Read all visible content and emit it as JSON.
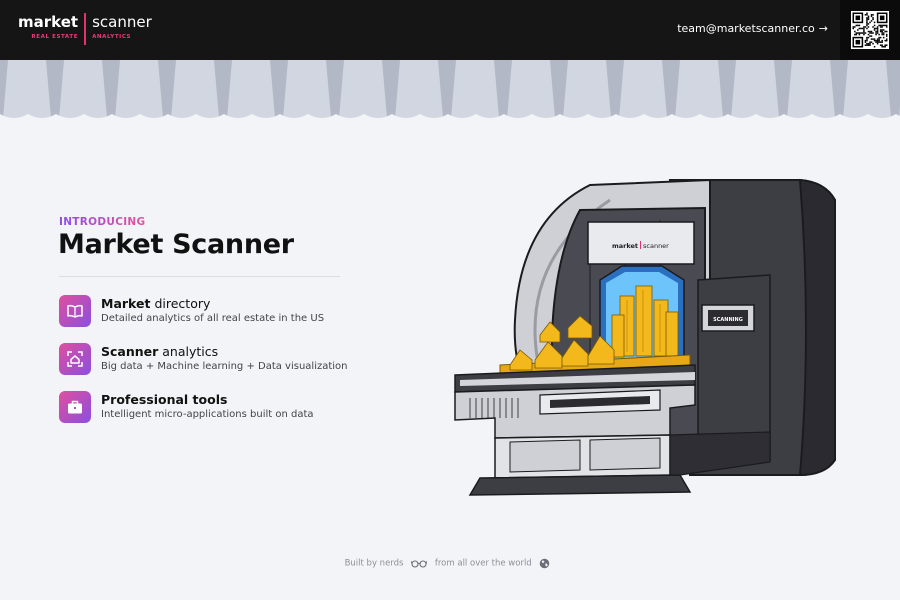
{
  "header": {
    "logo": {
      "word_left": "market",
      "word_right": "scanner",
      "sub_left": "REAL ESTATE",
      "sub_right": "ANALYTICS"
    },
    "email": "team@marketscanner.co",
    "email_arrow_icon": "arrow-right-icon",
    "qr_icon": "qr-code-icon"
  },
  "colors": {
    "header_bg": "#151515",
    "accent_pink": "#e6306f",
    "accent_purple": "#8a4de8",
    "page_bg": "#f3f4f7",
    "scanner_blue": "#3aa0f0",
    "gold": "#f2b81c"
  },
  "intro": {
    "eyebrow": "INTRODUCING",
    "title": "Market Scanner"
  },
  "features": [
    {
      "icon": "book-icon",
      "title_bold": "Market",
      "title_rest": " directory",
      "desc": "Detailed analytics of all real estate in the US"
    },
    {
      "icon": "scan-home-icon",
      "title_bold": "Scanner",
      "title_rest": " analytics",
      "desc": "Big data + Machine learning + Data visualization"
    },
    {
      "icon": "briefcase-icon",
      "title_bold": "Professional tools",
      "title_rest": "",
      "desc": "Intelligent micro-applications built on data"
    }
  ],
  "illustration": {
    "panel_logo_left": "market",
    "panel_logo_right": "scanner",
    "status_label": "SCANNING"
  },
  "footer": {
    "text_before": "Built by nerds",
    "text_after": "from all over the world",
    "icons": [
      "glasses-icon",
      "globe-icon"
    ]
  }
}
